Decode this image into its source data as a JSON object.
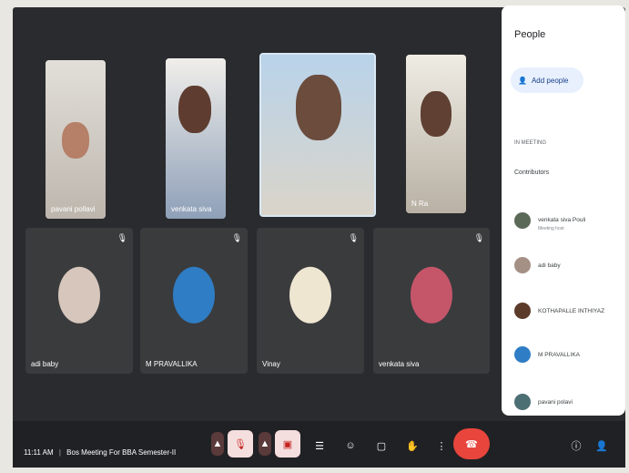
{
  "participants": [
    {
      "name": "pavani pollavi"
    },
    {
      "name": "venkata siva"
    },
    {
      "name": ""
    },
    {
      "name": "N Ra"
    },
    {
      "name": "adi baby"
    },
    {
      "name": "M PRAVALLIKA"
    },
    {
      "name": "Vinay"
    },
    {
      "name": "venkata siva"
    }
  ],
  "panel": {
    "title": "People",
    "add_people": "Add people",
    "section": "IN MEETING",
    "group": "Contributors",
    "people": [
      {
        "name": "venkata siva Pouli",
        "sub": "Meeting host"
      },
      {
        "name": "adi baby",
        "sub": ""
      },
      {
        "name": "KOTHAPALLE INTHIYAZ",
        "sub": ""
      },
      {
        "name": "M PRAVALLIKA",
        "sub": ""
      },
      {
        "name": "pavani polavi",
        "sub": ""
      }
    ]
  },
  "toolbar": {
    "time": "11:11 AM",
    "meeting_title": "Bos Meeting For BBA Semester-II",
    "end_call_color": "#e8453c"
  }
}
